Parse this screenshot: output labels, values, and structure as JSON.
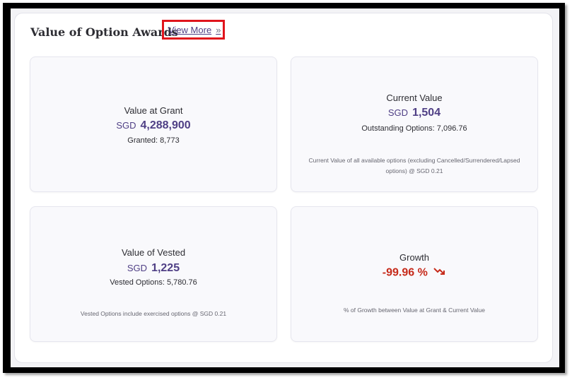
{
  "header": {
    "title": "Value of Option Awards",
    "view_more_label": "View More",
    "view_more_icon": "double-chevron-right-icon"
  },
  "cards": {
    "grant": {
      "title": "Value at Grant",
      "currency": "SGD",
      "value": "4,288,900",
      "sub_label": "Granted:",
      "sub_value": "8,773"
    },
    "current": {
      "title": "Current Value",
      "currency": "SGD",
      "value": "1,504",
      "sub_label": "Outstanding Options:",
      "sub_value": "7,096.76",
      "note": "Current Value of all available options (excluding Cancelled/Surrendered/Lapsed options) @ SGD 0.21"
    },
    "vested": {
      "title": "Value of Vested",
      "currency": "SGD",
      "value": "1,225",
      "sub_label": "Vested Options:",
      "sub_value": "5,780.76",
      "note": "Vested Options include exercised options @ SGD 0.21"
    },
    "growth": {
      "title": "Growth",
      "value": "-99.96 %",
      "trend_icon": "trending-down-icon",
      "note": "% of Growth between Value at Grant & Current Value"
    }
  },
  "colors": {
    "accent": "#4f3f85",
    "negative": "#c62a1a",
    "highlight_border": "#e0141c"
  }
}
